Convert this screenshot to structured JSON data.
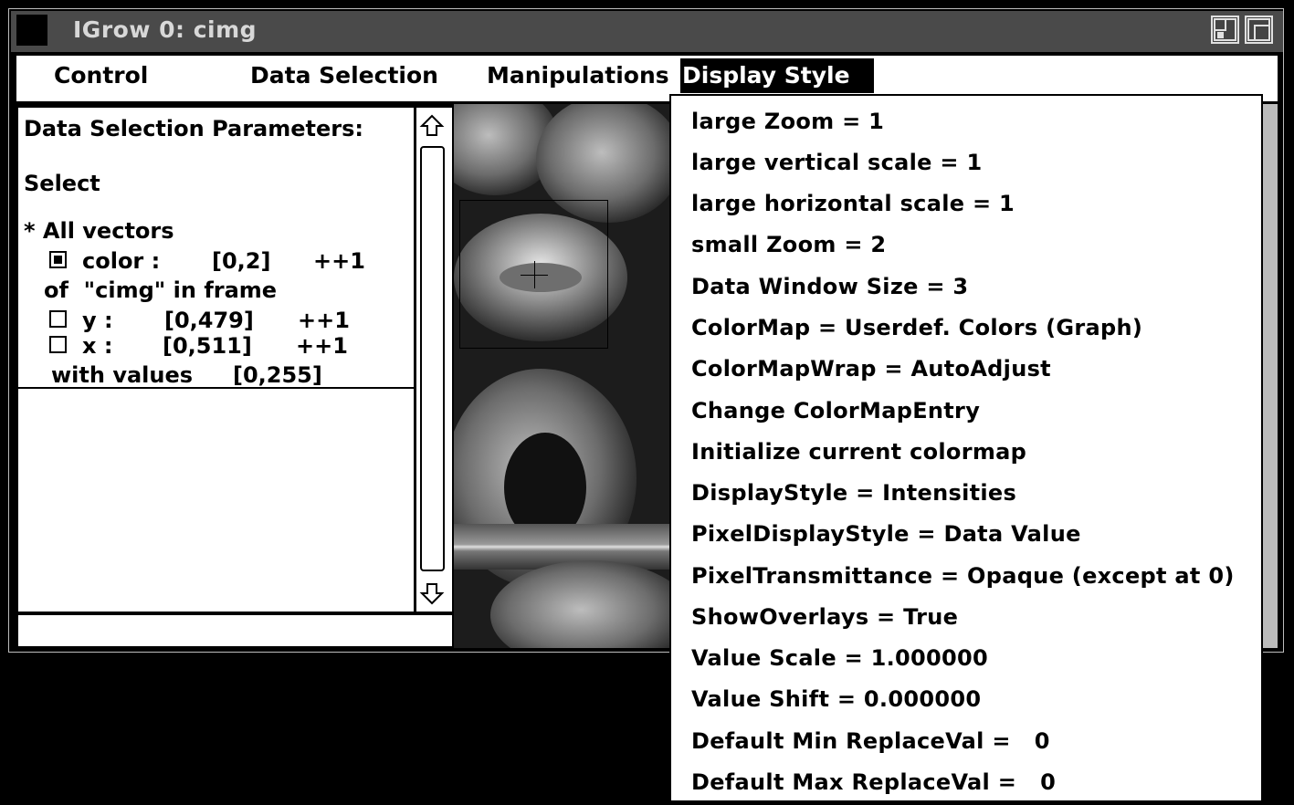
{
  "window": {
    "title": "IGrow 0: cimg"
  },
  "menubar": {
    "items": [
      {
        "label": "Control"
      },
      {
        "label": "Data Selection"
      },
      {
        "label": "Manipulations"
      },
      {
        "label": "Display Style",
        "active": true
      }
    ]
  },
  "panel": {
    "heading": "Data Selection Parameters:",
    "select": "Select",
    "all_vectors": "* All vectors",
    "color_label": "color :",
    "color_range": "[0,2]",
    "color_step": "++1",
    "color_checked": true,
    "of_line": "of  \"cimg\" in frame",
    "y_label": "y :",
    "y_range": "[0,479]",
    "y_step": "++1",
    "y_checked": false,
    "x_label": "x :",
    "x_range": "[0,511]",
    "x_step": "++1",
    "x_checked": false,
    "values_label": "with values",
    "values_range": "[0,255]"
  },
  "scrollbar": {
    "up_icon": "up-arrow-icon",
    "down_icon": "down-arrow-icon"
  },
  "dropdown": {
    "items": [
      "large Zoom = 1",
      "large vertical scale = 1",
      "large horizontal scale = 1",
      "small Zoom = 2",
      "Data Window Size = 3",
      "ColorMap = Userdef. Colors (Graph)",
      "ColorMapWrap = AutoAdjust",
      "Change ColorMapEntry",
      "Initialize current colormap",
      "DisplayStyle = Intensities",
      "PixelDisplayStyle = Data Value",
      "PixelTransmittance = Opaque (except at 0)",
      "ShowOverlays = True",
      "Value Scale = 1.000000",
      "Value Shift = 0.000000",
      "Default Min ReplaceVal =   0",
      "Default Max ReplaceVal =   0"
    ]
  },
  "colors": {
    "titlebar": "#4a4a4a",
    "background": "#000000",
    "menu_highlight": "#000000"
  }
}
